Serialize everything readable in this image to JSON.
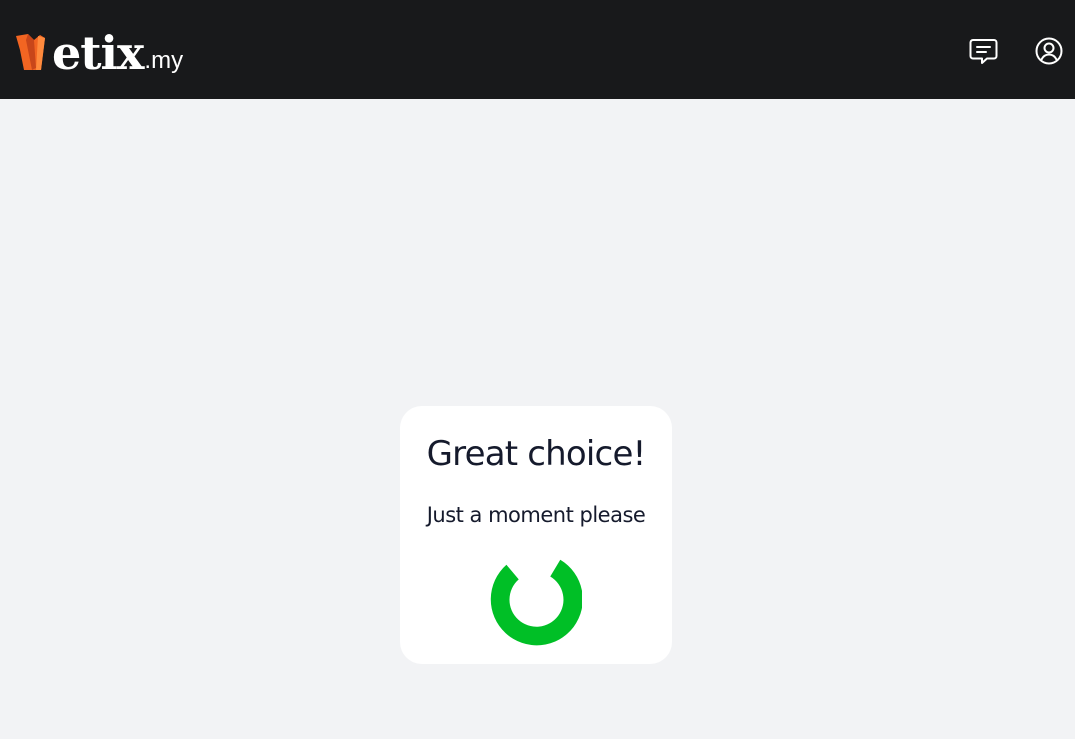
{
  "header": {
    "logo_main": "etix",
    "logo_suffix": ".my",
    "logo_icon": "ticket-stub-icon",
    "chat_icon": "chat-message-icon",
    "account_icon": "user-account-icon"
  },
  "card": {
    "title": "Great choice!",
    "subtitle": "Just a moment please",
    "spinner_icon": "loading-spinner-icon"
  },
  "colors": {
    "header_bg": "#18191b",
    "page_bg": "#f2f3f5",
    "card_bg": "#ffffff",
    "text": "#151a2c",
    "spinner": "#00bf26",
    "logo_accent": "#f26522"
  }
}
